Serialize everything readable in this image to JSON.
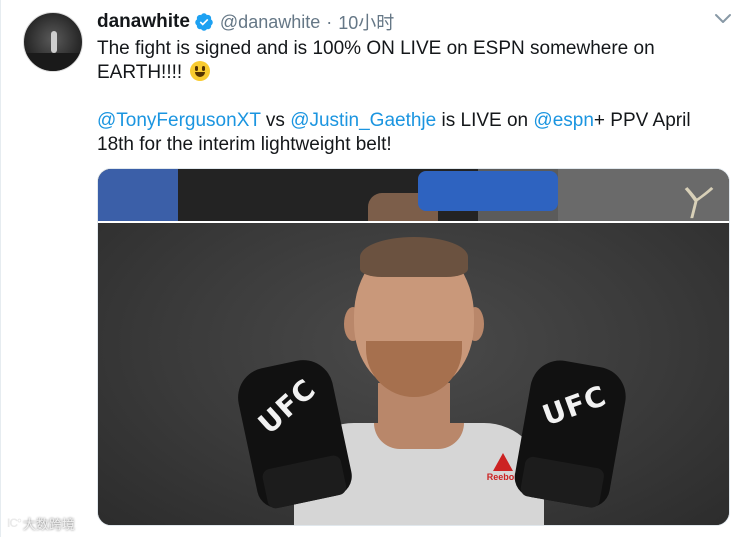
{
  "tweet": {
    "author_name": "danawhite",
    "author_handle": "@danawhite",
    "separator": "·",
    "timestamp": "10小时",
    "text_line1": "The fight is signed and is 100% ON LIVE on ESPN somewhere on EARTH!!!! ",
    "mention_1": "@TonyFergusonXT",
    "word_vs": " vs ",
    "mention_2": "@Justin_Gaethje",
    "word_mid": " is LIVE on ",
    "mention_3": "@espn",
    "text_tail": "+ PPV April 18th for the interim lightweight belt!",
    "media": {
      "top_photo_signature": "ㄚ",
      "glove_left_text": "UFC",
      "glove_right_text": "UFC",
      "shirt_logo_text": "Reebok"
    }
  },
  "icons": {
    "verified": "verified-badge-icon",
    "caret": "chevron-down-icon",
    "emoji": "grinning-face-icon"
  },
  "colors": {
    "link": "#1b95e0",
    "verified": "#1da1f2",
    "meta": "#657786"
  },
  "watermark": {
    "mark": "IC°",
    "text": "大数跨境"
  }
}
